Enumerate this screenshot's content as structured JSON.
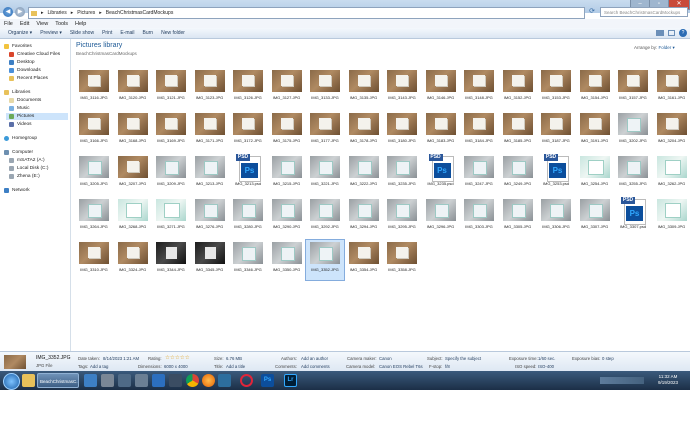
{
  "window": {
    "breadcrumb": [
      "Libraries",
      "Pictures",
      "BeachChristmasCardMockups"
    ],
    "search_placeholder": "Search BeachChristmasCardMockups"
  },
  "menu": [
    "File",
    "Edit",
    "View",
    "Tools",
    "Help"
  ],
  "toolbar": {
    "organize": "Organize ▾",
    "preview": "Preview ▾",
    "slideshow": "Slide show",
    "print": "Print",
    "email": "E-mail",
    "burn": "Burn",
    "new_folder": "New folder"
  },
  "sidebar": {
    "favorites": "Favorites",
    "fav_items": [
      "Creative Cloud Files",
      "Desktop",
      "Downloads",
      "Recent Places"
    ],
    "libraries": "Libraries",
    "lib_items": [
      "Documents",
      "Music",
      "Pictures",
      "Videos"
    ],
    "homegroup": "Homegroup",
    "computer": "Computer",
    "comp_items": [
      "mSATA2 (A:)",
      "Local Disk (C:)",
      "Zhena (E:)"
    ],
    "network": "Network"
  },
  "main": {
    "title": "Pictures library",
    "subtitle": "BeachChristmasCardMockups",
    "arrange_label": "Arrange by:",
    "arrange_value": "Folder ▾"
  },
  "files": [
    [
      "IMG_3116.JPG",
      "IMG_3120.JPG",
      "IMG_3121.JPG",
      "IMG_3123.JPG",
      "IMG_3126.JPG",
      "IMG_3127.JPG",
      "IMG_3133.JPG",
      "IMG_3135.JPG",
      "IMG_3143.JPG",
      "IMG_3146.JPG",
      "IMG_3148.JPG",
      "IMG_3152.JPG",
      "IMG_3153.JPG",
      "IMG_3154.JPG",
      "IMG_3157.JPG",
      "IMG_3161.JPG"
    ],
    [
      "IMG_3166.JPG",
      "IMG_3168.JPG",
      "IMG_3169.JPG",
      "IMG_3171.JPG",
      "IMG_3172.JPG",
      "IMG_3175.JPG",
      "IMG_3177.JPG",
      "IMG_3178.JPG",
      "IMG_3180.JPG",
      "IMG_3183.JPG",
      "IMG_3184.JPG",
      "IMG_3185.JPG",
      "IMG_3187.JPG",
      "IMG_3191.JPG",
      "IMG_3202.JPG",
      "IMG_3204.JPG"
    ],
    [
      "IMG_3205.JPG",
      "IMG_3207.JPG",
      "IMG_3209.JPG",
      "IMG_3213.JPG",
      "IMG_3213.psd",
      "IMG_3215.JPG",
      "IMG_3221.JPG",
      "IMG_3222.JPG",
      "IMG_3235.JPG",
      "IMG_3235.psd",
      "IMG_3247.JPG",
      "IMG_3249.JPG",
      "IMG_3253.psd",
      "IMG_3254.JPG",
      "IMG_3255.JPG",
      "IMG_3262.JPG"
    ],
    [
      "IMG_3264.JPG",
      "IMG_3268.JPG",
      "IMG_3271.JPG",
      "IMG_3276.JPG",
      "IMG_3280.JPG",
      "IMG_3290.JPG",
      "IMG_3292.JPG",
      "IMG_3294.JPG",
      "IMG_3295.JPG",
      "IMG_3296.JPG",
      "IMG_3303.JPG",
      "IMG_3305.JPG",
      "IMG_3306.JPG",
      "IMG_3307.JPG",
      "IMG_3307.psd",
      "IMG_3309.JPG"
    ],
    [
      "IMG_3310.JPG",
      "IMG_3324.JPG",
      "IMG_3344.JPG",
      "IMG_3345.JPG",
      "IMG_3346.JPG",
      "IMG_3350.JPG",
      "IMG_3352.JPG",
      "IMG_3354.JPG",
      "IMG_3358.JPG"
    ]
  ],
  "thumb_styles": [
    [
      "wood",
      "wood",
      "wood",
      "wood",
      "wood",
      "wood",
      "wood",
      "wood",
      "wood",
      "wood",
      "wood",
      "wood",
      "wood",
      "wood",
      "wood",
      "wood"
    ],
    [
      "wood",
      "wood",
      "wood",
      "wood",
      "wood",
      "wood",
      "wood",
      "wood",
      "wood",
      "wood",
      "wood",
      "wood",
      "wood",
      "wood",
      "gray",
      "wood"
    ],
    [
      "gray",
      "wood",
      "gray",
      "gray",
      "psd",
      "gray",
      "gray",
      "gray",
      "gray",
      "psd",
      "gray",
      "gray",
      "psd",
      "mint",
      "gray",
      "mint"
    ],
    [
      "gray",
      "mint",
      "mint",
      "gray",
      "gray",
      "gray",
      "gray",
      "gray",
      "gray",
      "gray",
      "gray",
      "gray",
      "gray",
      "gray",
      "psd",
      "mint"
    ],
    [
      "wood",
      "wood",
      "dark",
      "dark",
      "gray",
      "gray",
      "gray",
      "wood",
      "wood"
    ]
  ],
  "selected_file": "IMG_3352.JPG",
  "details": {
    "filename": "IMG_3352.JPG",
    "type": "JPG File",
    "date_taken_label": "Date taken:",
    "date_taken": "8/14/2023 1:21 AM",
    "tags_label": "Tags:",
    "tags": "Add a tag",
    "rating_label": "Rating:",
    "rating_stars": "☆☆☆☆☆",
    "dimensions_label": "Dimensions:",
    "dimensions": "6000 x 4000",
    "size_label": "Size:",
    "size": "6.76 MB",
    "title_label": "Title:",
    "title": "Add a title",
    "authors_label": "Authors:",
    "authors": "Add an author",
    "comments_label": "Comments:",
    "comments": "Add comments",
    "camera_maker_label": "Camera maker:",
    "camera_maker": "Canon",
    "camera_model_label": "Camera model:",
    "camera_model": "Canon EOS Rebel T6s",
    "subject_label": "Subject:",
    "subject": "Specify the subject",
    "fstop_label": "F-stop:",
    "fstop": "f/8",
    "exposure_time_label": "Exposure time:",
    "exposure_time": "1/60 sec.",
    "iso_label": "ISO speed:",
    "iso": "ISO-400",
    "exposure_bias_label": "Exposure bias:",
    "exposure_bias": "0 step"
  },
  "taskbar": {
    "active_window": "BeachChristmasC...",
    "time": "11:32 AM",
    "date": "9/19/2023"
  },
  "colors": {
    "accent": "#1e5a96",
    "selection": "#cde4fb",
    "taskbar": "#1c2f47"
  }
}
